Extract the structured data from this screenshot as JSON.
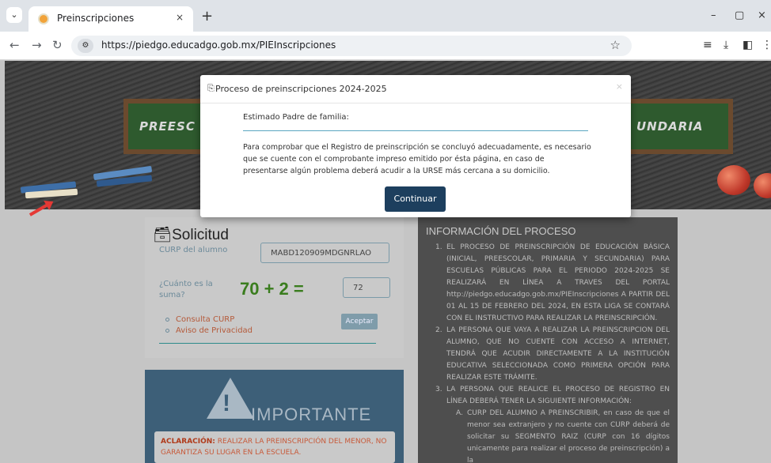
{
  "browser": {
    "tab_title": "Preinscripciones",
    "tab_close": "×",
    "new_tab": "+",
    "url": "https://piedgo.educadgo.gob.mx/PIEInscripciones",
    "minimize": "–",
    "maximize": "▢",
    "close": "×"
  },
  "banner": {
    "left_board_text": "PREESC",
    "right_board_text": "UNDARIA"
  },
  "solicitud": {
    "title": "Solicitud",
    "curp_label": "CURP del alumno",
    "curp_value": "MABD120909MDGNRLAO",
    "sum_label": "¿Cuánto es la suma?",
    "captcha": "70 + 2 =",
    "sum_value": "72",
    "links": [
      "Consulta CURP",
      "Aviso de Privacidad"
    ],
    "accept_label": "Aceptar"
  },
  "importante": {
    "title": "IMPORTANTE",
    "note_label": "ACLARACIÓN:",
    "note_text": "REALIZAR LA PREINSCRIPCIÓN DEL MENOR, NO GARANTIZA SU LUGAR EN LA ESCUELA."
  },
  "info": {
    "title": "INFORMACIÓN DEL PROCESO",
    "items": [
      {
        "num": "1.",
        "text": "EL PROCESO DE PREINSCRIPCIÓN DE EDUCACIÓN BÁSICA (INICIAL, PREESCOLAR, PRIMARIA Y SECUNDARIA) PARA ESCUELAS PÚBLICAS PARA EL PERIODO 2024-2025 SE REALIZARÁ EN LÍNEA A TRAVES DEL PORTAL http://piedgo.educadgo.gob.mx/PIEInscripciones A PARTIR DEL 01 AL 15 DE FEBRERO DEL 2024, EN ESTA LIGA SE CONTARÁ CON EL INSTRUCTIVO PARA REALIZAR LA PREINSCRIPCIÓN."
      },
      {
        "num": "2.",
        "text": "LA PERSONA QUE VAYA A REALIZAR LA PREINSCRIPCION DEL ALUMNO, QUE NO CUENTE CON ACCESO A INTERNET, TENDRÁ QUE ACUDIR DIRECTAMENTE A LA INSTITUCIÓN EDUCATIVA SELECCIONADA COMO PRIMERA OPCIÓN PARA REALIZAR ESTE TRÁMITE."
      },
      {
        "num": "3.",
        "text": "LA PERSONA QUE REALICE EL PROCESO DE REGISTRO EN LÍNEA DEBERÁ TENER LA SIGUIENTE INFORMACIÓN:"
      }
    ],
    "sub_items": [
      {
        "num": "A.",
        "text": "CURP DEL ALUMNO A PREINSCRIBIR, en caso de que el menor sea extranjero y no cuente con CURP deberá de solicitar su SEGMENTO RAIZ (CURP con 16 dígitos unicamente para realizar el proceso de preinscripción) a la"
      }
    ]
  },
  "modal": {
    "title": "Proceso de preinscripciones 2024-2025",
    "close": "×",
    "greeting": "Estimado Padre de familia:",
    "body": "Para comprobar que el Registro de preinscripción se concluyó adecuadamente, es necesario que se cuente con el comprobante impreso emitido por ésta página, en caso de presentarse algún problema deberá acudir a la URSE más cercana a su domicilio.",
    "continue_label": "Continuar"
  }
}
